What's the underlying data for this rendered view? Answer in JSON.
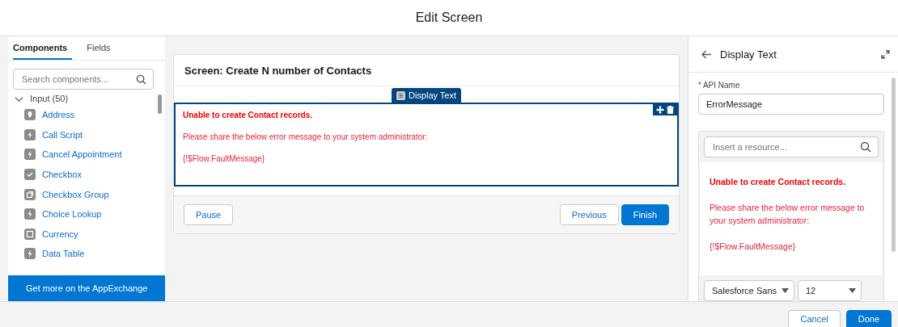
{
  "window": {
    "title": "Edit Screen"
  },
  "sidebar": {
    "tabs": [
      {
        "label": "Components",
        "selected": true
      },
      {
        "label": "Fields",
        "selected": false
      }
    ],
    "search": {
      "placeholder": "Search components..."
    },
    "group": {
      "label": "Input (50)",
      "expanded": true
    },
    "items": [
      {
        "label": "Address",
        "kind": "pin"
      },
      {
        "label": "Call Script",
        "kind": "bolt"
      },
      {
        "label": "Cancel Appointment",
        "kind": "bolt"
      },
      {
        "label": "Checkbox",
        "kind": "check"
      },
      {
        "label": "Checkbox Group",
        "kind": "copy"
      },
      {
        "label": "Choice Lookup",
        "kind": "bolt"
      },
      {
        "label": "Currency",
        "kind": "square"
      },
      {
        "label": "Data Table",
        "kind": "bolt"
      }
    ],
    "footer_link": "Get more on the AppExchange"
  },
  "canvas": {
    "screen_title": "Screen: Create N number of Contacts",
    "component_tab": "Display Text",
    "lines": [
      {
        "text": "Unable to create Contact records.",
        "kind": "heading"
      },
      {
        "text": "Please share the below error message to your system administrator:",
        "kind": "body"
      },
      {
        "text": "{!$Flow.FaultMessage}",
        "kind": "body"
      }
    ],
    "buttons": [
      {
        "label": "Pause",
        "kind": "neutral"
      },
      {
        "label": "Previous",
        "kind": "neutral"
      },
      {
        "label": "Finish",
        "kind": "brand"
      }
    ]
  },
  "properties": {
    "title": "Display Text",
    "api_name": {
      "label": "API Name",
      "required_mark": "*",
      "value": "ErrorMessage"
    },
    "resource": {
      "placeholder": "Insert a resource..."
    },
    "lines": [
      {
        "text": "Unable to create Contact records.",
        "kind": "heading"
      },
      {
        "text": "Please share the below error message to your system administrator:",
        "kind": "body"
      },
      {
        "text": "{!$Flow.FaultMessage}",
        "kind": "body"
      }
    ],
    "font": "Salesforce Sans",
    "size": "12"
  },
  "footer": {
    "buttons": [
      {
        "label": "Cancel",
        "kind": "neutral"
      },
      {
        "label": "Done",
        "kind": "brand"
      }
    ]
  }
}
